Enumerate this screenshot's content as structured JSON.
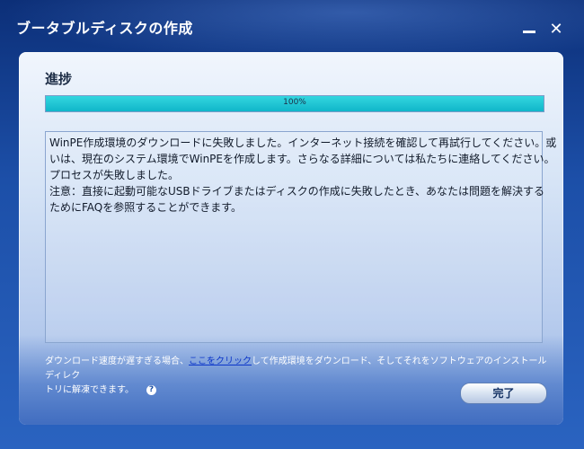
{
  "window": {
    "title": "ブータブルディスクの作成",
    "minimize_label": "−",
    "close_label": "✕"
  },
  "progress_section": {
    "title": "進捗",
    "percent_text": "100%",
    "fill_percent": 100
  },
  "message": {
    "lines": [
      "WinPE作成環境のダウンロードに失敗しました。インターネット接続を確認して再試行してください。或",
      "いは、現在のシステム環境でWinPEを作成します。さらなる詳細については私たちに連絡してください。",
      "プロセスが失敗しました。",
      "注意：直接に起動可能なUSBドライブまたはディスクの作成に失敗したとき、あなたは問題を解決する",
      "ためにFAQを参照することができます。"
    ]
  },
  "footer": {
    "text_before_link": "ダウンロード速度が遅すぎる場合、",
    "link_text": "ここをクリック",
    "text_after_link": "して作成環境をダウンロード、そしてそれをソフトウェアのインストールディレク",
    "text_second_line": "トリに解凍できます。",
    "help_symbol": "?"
  },
  "buttons": {
    "finish_label": "完了"
  },
  "colors": {
    "progress_fill": "#10b6c9",
    "link": "#0b35c9",
    "window_bg": "#1c4fa8"
  }
}
